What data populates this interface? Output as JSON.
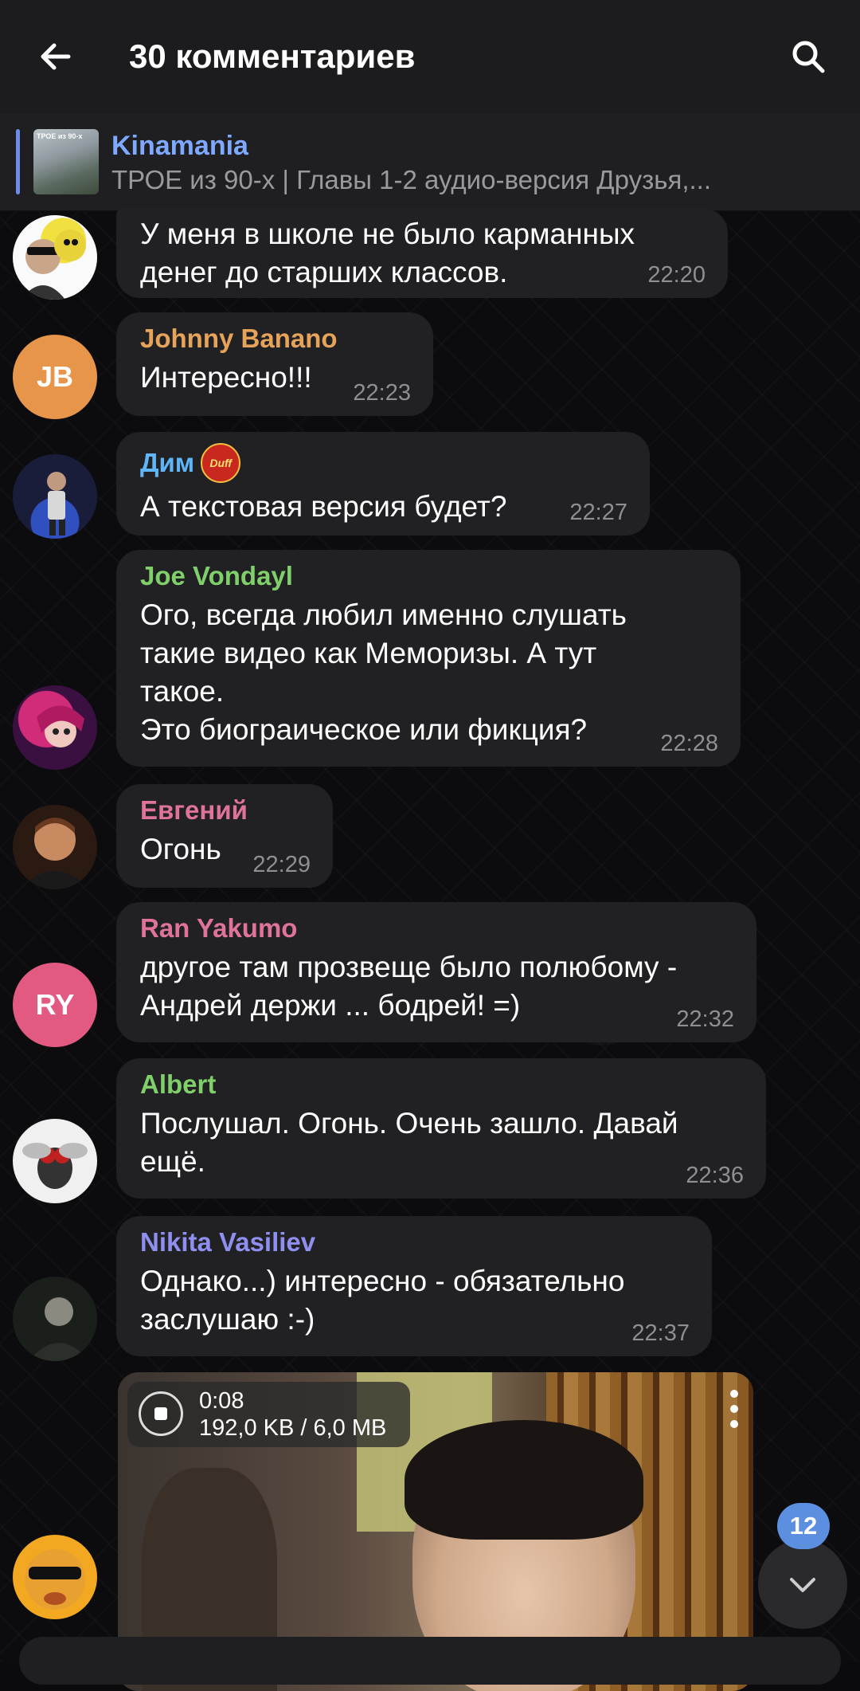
{
  "header": {
    "title": "30 комментариев"
  },
  "pinned": {
    "channel": "Kinamania",
    "thumb_caption": "ТРОЕ из 90-х",
    "text": "ТРОЕ из 90-х | Главы 1-2 аудио-версия  Друзья,..."
  },
  "messages": [
    {
      "sender": "",
      "text": "У меня в школе не было карманных денег до старших классов.",
      "time": "22:20"
    },
    {
      "sender": "Johnny Banano",
      "initials": "JB",
      "text": "Интересно!!!",
      "time": "22:23",
      "color": "#e8a35a"
    },
    {
      "sender": "Дим",
      "text": "А текстовая версия будет?",
      "time": "22:27",
      "color": "#5eb5f7",
      "badge": "Duff"
    },
    {
      "sender": "Joe Vondayl",
      "text": "Ого, всегда любил именно слушать такие видео как Меморизы. А тут такое.\nЭто биограическое или фикция?",
      "time": "22:28",
      "color": "#7fcf6a"
    },
    {
      "sender": "Евгений",
      "text": "Огонь",
      "time": "22:29",
      "color": "#e0739a"
    },
    {
      "sender": "Ran Yakumo",
      "initials": "RY",
      "text": "другое там прозвеще было полюбому - Андрей держи ... бодрей! =)",
      "time": "22:32",
      "color": "#e0739a"
    },
    {
      "sender": "Albert",
      "text": "Послушал. Огонь. Очень зашло. Давай ещё.",
      "time": "22:36",
      "color": "#7fcf6a"
    },
    {
      "sender": "Nikita Vasiliev",
      "text": "Однако...) интересно - обязательно заслушаю :-)",
      "time": "22:37",
      "color": "#8f8ff0"
    }
  ],
  "video": {
    "duration": "0:08",
    "size": "192,0 KB / 6,0 MB"
  },
  "unread_count": "12"
}
